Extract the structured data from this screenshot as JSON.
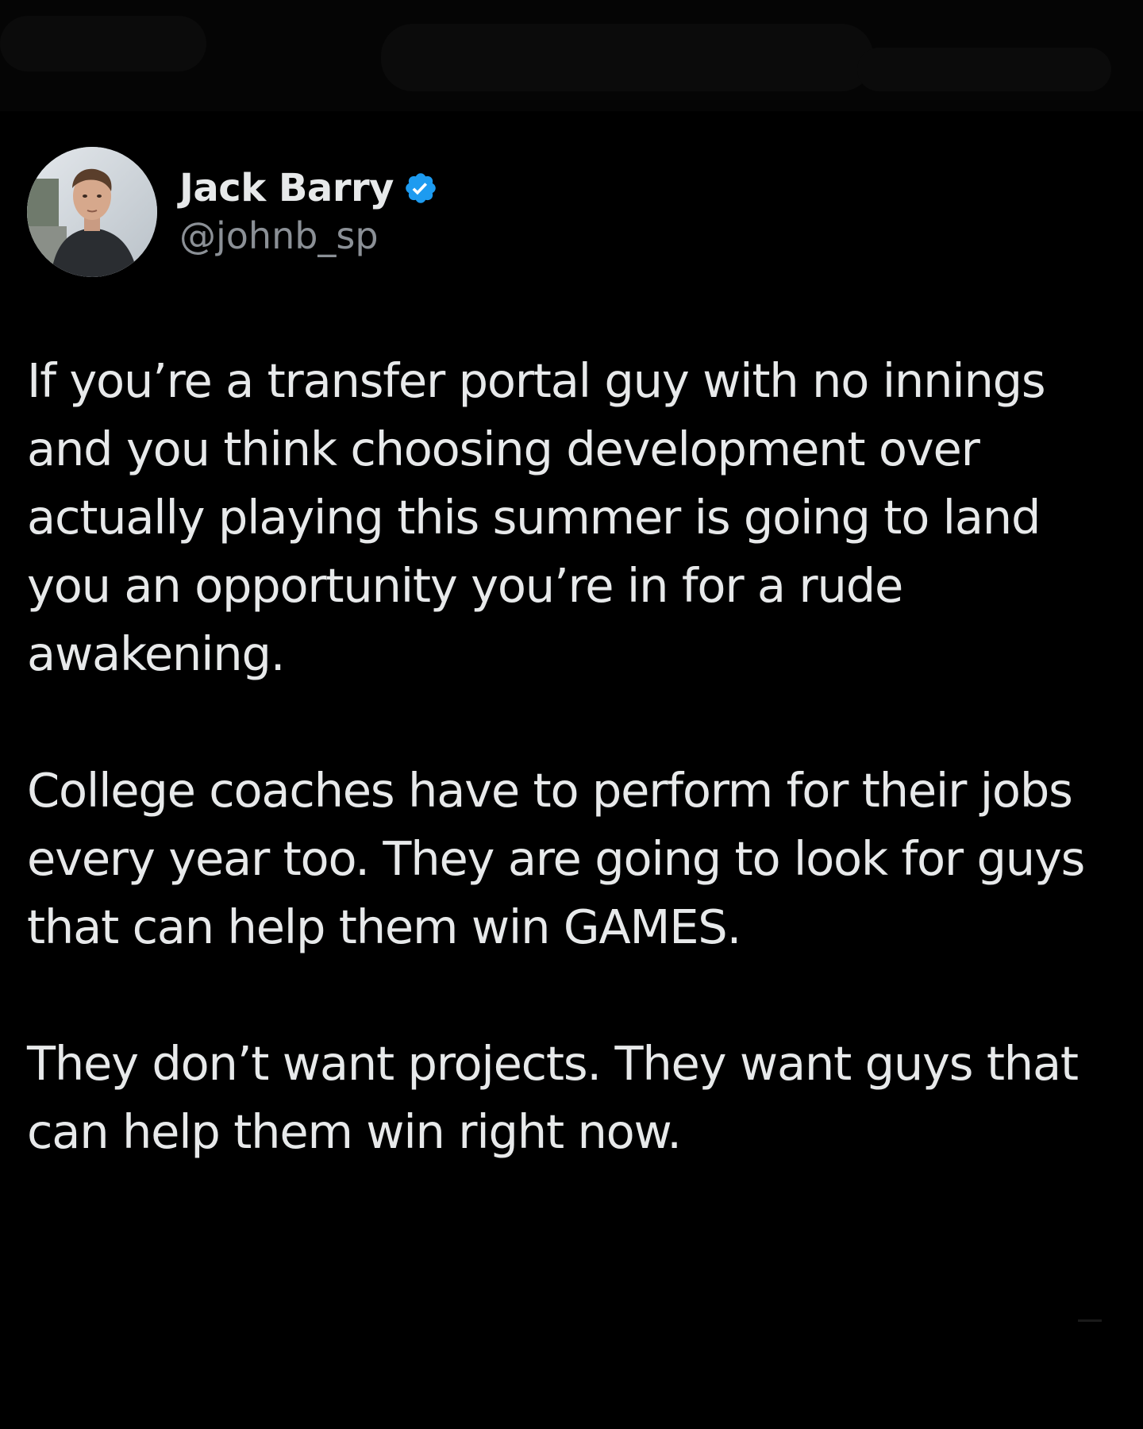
{
  "author": {
    "name": "Jack Barry",
    "handle": "@johnb_sp",
    "verified_icon": "verified-badge-icon",
    "verified_color": "#1d9bf0"
  },
  "tweet": {
    "paragraphs": [
      "If you’re a transfer portal guy with no innings and you think choosing development over actually playing this summer is going to land you an opportunity you’re in for a rude awakening.",
      "College coaches have to perform for their jobs every year too. They are going to look for guys that can help them win GAMES.",
      "They don’t want projects. They want guys that can help them win right now."
    ]
  },
  "colors": {
    "background": "#000000",
    "text": "#e7e9ea",
    "secondary_text": "#8b9096"
  }
}
